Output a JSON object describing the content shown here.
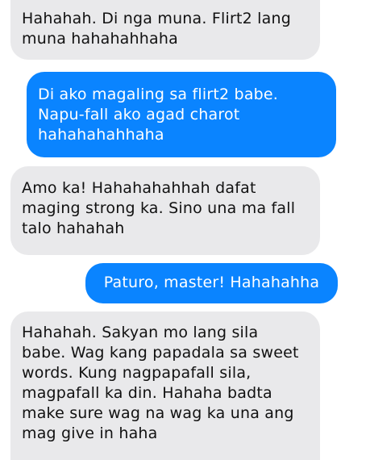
{
  "conversation": {
    "messages": [
      {
        "direction": "received",
        "text": "Hahahah. Di nga muna. Flirt2 lang\nmuna hahahahhaha"
      },
      {
        "direction": "sent",
        "text": "Di ako magaling sa flirt2 babe.\nNapu-fall ako agad charot\nhahahahahhaha"
      },
      {
        "direction": "received",
        "text": "Amo ka! Hahahahahhah dafat\nmaging strong ka. Sino una ma fall\ntalo hahahah"
      },
      {
        "direction": "sent",
        "text": "Paturo, master! Hahahahha"
      },
      {
        "direction": "received",
        "text": "Hahahah. Sakyan mo lang sila\nbabe. Wag kang papadala sa sweet\nwords. Kung nagpapafall sila,\nmagpafall ka din. Hahaha badta\nmake sure wag na wag ka una ang\nmag give in haha"
      }
    ]
  },
  "colors": {
    "sent_bubble": "#0a84ff",
    "received_bubble": "#e9e9eb",
    "background": "#ffffff"
  }
}
